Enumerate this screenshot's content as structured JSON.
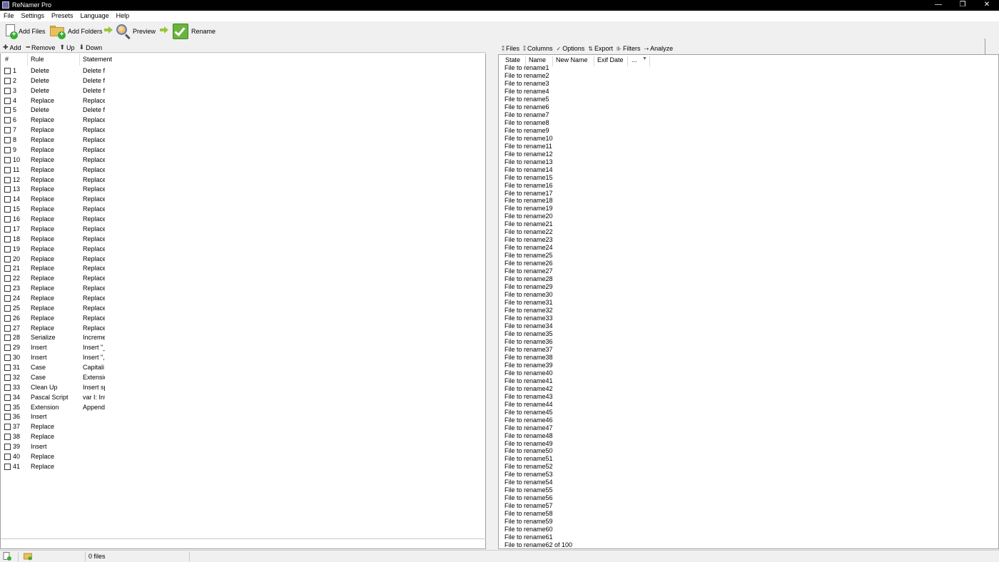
{
  "window": {
    "title": "ReNamer Pro",
    "controls": [
      "—",
      "❐",
      "✕"
    ]
  },
  "menu": [
    "File",
    "Settings",
    "Presets",
    "Language",
    "Help"
  ],
  "toolbar": {
    "add_files": "Add Files",
    "add_folders": "Add Folders",
    "preview": "Preview",
    "rename": "Rename"
  },
  "rules_toolbar": {
    "add": "Add",
    "remove": "Remove",
    "up": "Up",
    "down": "Down"
  },
  "rules_header": {
    "num": "#",
    "rule": "Rule",
    "statement": "Statement"
  },
  "rules": [
    {
      "num": "1",
      "rule": "Delete",
      "statement": "Delete f"
    },
    {
      "num": "2",
      "rule": "Delete",
      "statement": "Delete f"
    },
    {
      "num": "3",
      "rule": "Delete",
      "statement": "Delete f"
    },
    {
      "num": "4",
      "rule": "Replace",
      "statement": "Replace"
    },
    {
      "num": "5",
      "rule": "Delete",
      "statement": "Delete f"
    },
    {
      "num": "6",
      "rule": "Replace",
      "statement": "Replace"
    },
    {
      "num": "7",
      "rule": "Replace",
      "statement": "Replace"
    },
    {
      "num": "8",
      "rule": "Replace",
      "statement": "Replace"
    },
    {
      "num": "9",
      "rule": "Replace",
      "statement": "Replace"
    },
    {
      "num": "10",
      "rule": "Replace",
      "statement": "Replace"
    },
    {
      "num": "11",
      "rule": "Replace",
      "statement": "Replace"
    },
    {
      "num": "12",
      "rule": "Replace",
      "statement": "Replace"
    },
    {
      "num": "13",
      "rule": "Replace",
      "statement": "Replace"
    },
    {
      "num": "14",
      "rule": "Replace",
      "statement": "Replace"
    },
    {
      "num": "15",
      "rule": "Replace",
      "statement": "Replace"
    },
    {
      "num": "16",
      "rule": "Replace",
      "statement": "Replace"
    },
    {
      "num": "17",
      "rule": "Replace",
      "statement": "Replace"
    },
    {
      "num": "18",
      "rule": "Replace",
      "statement": "Replace"
    },
    {
      "num": "19",
      "rule": "Replace",
      "statement": "Replace"
    },
    {
      "num": "20",
      "rule": "Replace",
      "statement": "Replace"
    },
    {
      "num": "21",
      "rule": "Replace",
      "statement": "Replace"
    },
    {
      "num": "22",
      "rule": "Replace",
      "statement": "Replace"
    },
    {
      "num": "23",
      "rule": "Replace",
      "statement": "Replace"
    },
    {
      "num": "24",
      "rule": "Replace",
      "statement": "Replace"
    },
    {
      "num": "25",
      "rule": "Replace",
      "statement": "Replace"
    },
    {
      "num": "26",
      "rule": "Replace",
      "statement": "Replace"
    },
    {
      "num": "27",
      "rule": "Replace",
      "statement": "Replace"
    },
    {
      "num": "28",
      "rule": "Serialize",
      "statement": "Increme"
    },
    {
      "num": "29",
      "rule": "Insert",
      "statement": "Insert \"_"
    },
    {
      "num": "30",
      "rule": "Insert",
      "statement": "Insert \","
    },
    {
      "num": "31",
      "rule": "Case",
      "statement": "Capitali"
    },
    {
      "num": "32",
      "rule": "Case",
      "statement": "Extensic"
    },
    {
      "num": "33",
      "rule": "Clean Up",
      "statement": "Insert sp"
    },
    {
      "num": "34",
      "rule": "Pascal Script",
      "statement": "var I: Int"
    },
    {
      "num": "35",
      "rule": "Extension",
      "statement": "Append"
    },
    {
      "num": "36",
      "rule": "Insert",
      "statement": ""
    },
    {
      "num": "37",
      "rule": "Replace",
      "statement": ""
    },
    {
      "num": "38",
      "rule": "Replace",
      "statement": ""
    },
    {
      "num": "39",
      "rule": "Insert",
      "statement": ""
    },
    {
      "num": "40",
      "rule": "Replace",
      "statement": ""
    },
    {
      "num": "41",
      "rule": "Replace",
      "statement": ""
    }
  ],
  "files_toolbar": {
    "files": "Files",
    "columns": "Columns",
    "options": "Options",
    "export": "Export",
    "filters": "Filters",
    "analyze": "Analyze"
  },
  "files_header": {
    "state": "State",
    "name": "Name",
    "new_name": "New Name",
    "exif_date": "Exif Date",
    "more": "..."
  },
  "files": [
    "File to rename1",
    "File to rename2",
    "File to rename3",
    "File to rename4",
    "File to rename5",
    "File to rename6",
    "File to rename7",
    "File to rename8",
    "File to rename9",
    "File to rename10",
    "File to rename11",
    "File to rename12",
    "File to rename13",
    "File to rename14",
    "File to rename15",
    "File to rename16",
    "File to rename17",
    "File to rename18",
    "File to rename19",
    "File to rename20",
    "File to rename21",
    "File to rename22",
    "File to rename23",
    "File to rename24",
    "File to rename25",
    "File to rename26",
    "File to rename27",
    "File to rename28",
    "File to rename29",
    "File to rename30",
    "File to rename31",
    "File to rename32",
    "File to rename33",
    "File to rename34",
    "File to rename35",
    "File to rename36",
    "File to rename37",
    "File to rename38",
    "File to rename39",
    "File to rename40",
    "File to rename41",
    "File to rename42",
    "File to rename43",
    "File to rename44",
    "File to rename45",
    "File to rename46",
    "File to rename47",
    "File to rename48",
    "File to rename49",
    "File to rename50",
    "File to rename51",
    "File to rename52",
    "File to rename53",
    "File to rename54",
    "File to rename55",
    "File to rename56",
    "File to rename57",
    "File to rename58",
    "File to rename59",
    "File to rename60",
    "File to rename61",
    "File to rename62 of 100"
  ],
  "status": {
    "file_count": "0 files"
  }
}
